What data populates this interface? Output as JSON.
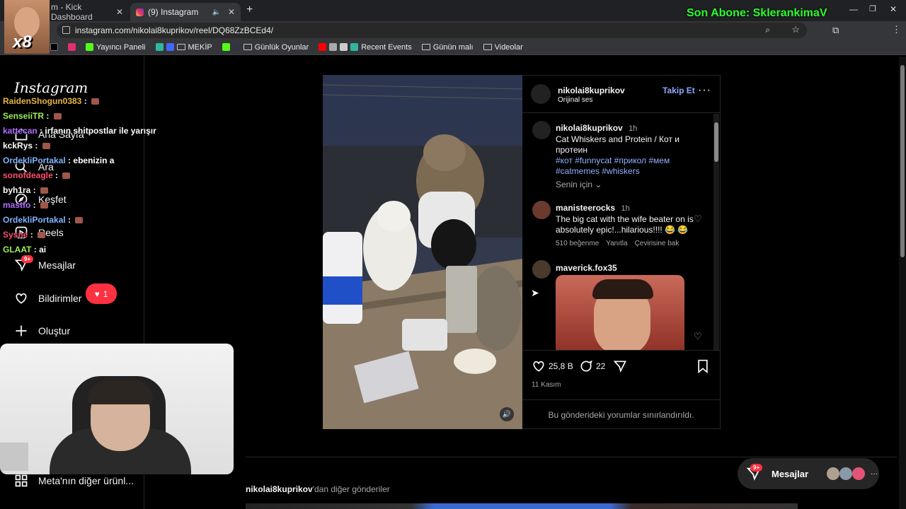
{
  "browser": {
    "tabs": [
      {
        "title": "m - Kick Dashboard"
      },
      {
        "title": "(9) Instagram"
      }
    ],
    "url": "instagram.com/nikolai8kuprikov/reel/DQ68ZzBCEd4/",
    "bookmarks": [
      "Yayıncı Paneli",
      "MEKİP",
      "Günlük Oyunlar",
      "Recent Events",
      "Günün malı",
      "Videolar"
    ]
  },
  "overlay": {
    "subscriber_banner": "Son Abone: SklerankimaV",
    "webcam_badge": "x8"
  },
  "chat": [
    {
      "user": "RaidenShogun0383",
      "user_color": "#e8b63c",
      "msg": ""
    },
    {
      "user": "SenseiiTR",
      "user_color": "#9aef5a",
      "msg": ""
    },
    {
      "user": "kattecan",
      "user_color": "#b06cff",
      "msg": "irfanın shitpostlar ile yarışır"
    },
    {
      "user": "kckRys",
      "user_color": "#ffffff",
      "msg": ""
    },
    {
      "user": "OrdekliPortakal",
      "user_color": "#7fb4ff",
      "msg": "ebenizin a"
    },
    {
      "user": "sonofdeagle",
      "user_color": "#ff4d6d",
      "msg": ""
    },
    {
      "user": "byh1ra",
      "user_color": "#ffffff",
      "msg": ""
    },
    {
      "user": "mastfo",
      "user_color": "#b06cff",
      "msg": ""
    },
    {
      "user": "OrdekliPortakal",
      "user_color": "#7fb4ff",
      "msg": ""
    },
    {
      "user": "Sysne",
      "user_color": "#ff4d6d",
      "msg": ""
    },
    {
      "user": "GLAAT",
      "user_color": "#9aef5a",
      "msg": "ai"
    }
  ],
  "sidebar": {
    "logo": "Instagram",
    "items": [
      {
        "label": "Ana Sayfa",
        "icon": "home-icon"
      },
      {
        "label": "Ara",
        "icon": "search-icon"
      },
      {
        "label": "Keşfet",
        "icon": "compass-icon"
      },
      {
        "label": "Reels",
        "icon": "reels-icon"
      },
      {
        "label": "Mesajlar",
        "icon": "messenger-icon",
        "badge": "9+"
      },
      {
        "label": "Bildirimler",
        "icon": "heart-icon"
      },
      {
        "label": "Oluştur",
        "icon": "plus-icon"
      }
    ],
    "notif_count": "1",
    "footer": "Meta'nın diğer ürünl..."
  },
  "post": {
    "author": "nikolai8kuprikov",
    "audio": "Orijinal ses",
    "follow_label": "Takip Et",
    "caption_time": "1h",
    "caption": "Cat Whiskers and Protein / Кот и протеин",
    "hashtags": "#кот #funnycat #прикол #мем #catmemes #whiskers",
    "for_you": "Senin için",
    "comments": [
      {
        "user": "manisteerocks",
        "time": "1h",
        "text": "The big cat with the wife beater on is absolutely epic!...hilarious!!!! 😂 😂",
        "likes": "510 beğenme",
        "reply": "Yanıtla",
        "translate": "Çevirisine bak"
      },
      {
        "user": "maverick.fox35",
        "time": "",
        "text": "",
        "likes": "",
        "reply": "",
        "translate": ""
      }
    ],
    "like_count": "25,8 B",
    "comment_count": "22",
    "date": "11 Kasım",
    "restricted": "Bu gönderideki yorumlar sınırlandırıldı."
  },
  "more_posts": {
    "author": "nikolai8kuprikov",
    "suffix": "'dan diğer gönderiler"
  },
  "messages_pill": {
    "label": "Mesajlar",
    "badge": "9+"
  }
}
